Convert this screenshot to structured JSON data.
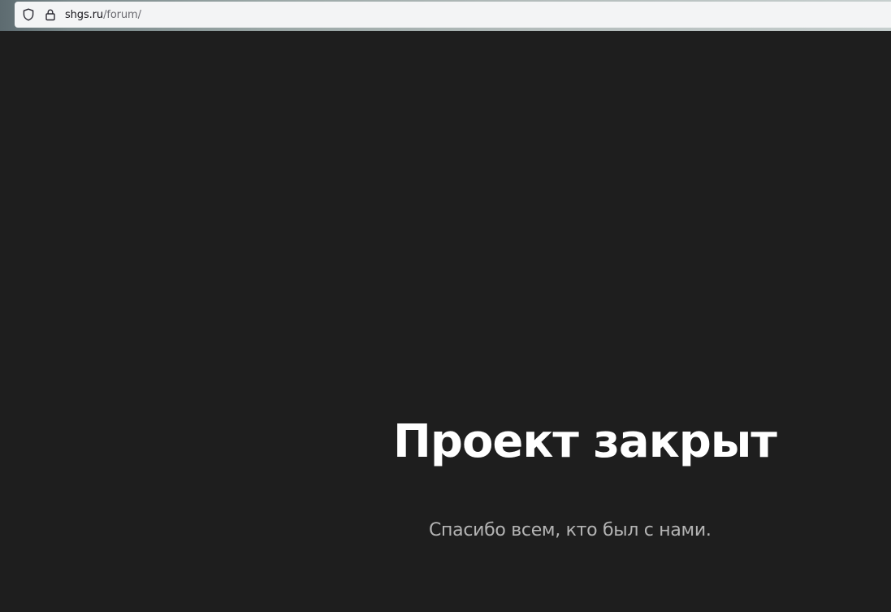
{
  "browser": {
    "url_domain": "shgs.ru",
    "url_path": "/forum/",
    "shield_icon": "shield-icon",
    "lock_icon": "lock-icon"
  },
  "page": {
    "title": "Проект закрыт",
    "subtitle": "Спасибо всем, кто был с нами.",
    "background_color": "#1e1e1e",
    "title_color": "#ffffff",
    "subtitle_color": "#b4b4b4"
  }
}
